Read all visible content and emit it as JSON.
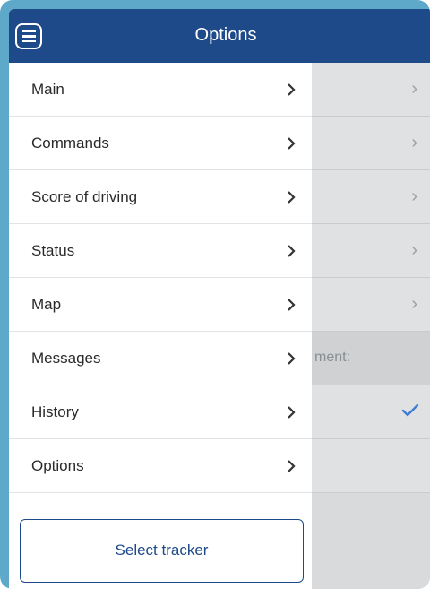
{
  "header": {
    "title": "Options",
    "menu_icon": "hamburger-menu-icon"
  },
  "drawer": {
    "items": [
      {
        "label": "Main"
      },
      {
        "label": "Commands"
      },
      {
        "label": "Score of driving"
      },
      {
        "label": "Status"
      },
      {
        "label": "Map"
      },
      {
        "label": "Messages"
      },
      {
        "label": "History"
      },
      {
        "label": "Options"
      }
    ],
    "select_tracker_label": "Select tracker"
  },
  "background": {
    "partial_text": "ment:",
    "chevron_icon": "chevron-right-icon",
    "check_icon": "checkmark-icon"
  },
  "colors": {
    "primary": "#1e4a8a",
    "frame": "#5ea9c9",
    "check": "#3f7bd8"
  }
}
